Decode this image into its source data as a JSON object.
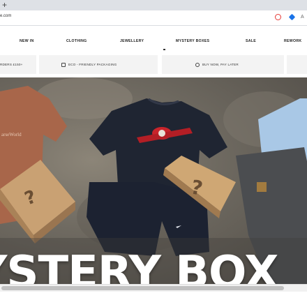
{
  "browser": {
    "new_tab_glyph": "+",
    "url": "e.com",
    "ext_more": "A"
  },
  "nav": {
    "items": [
      {
        "label": "NEW IN"
      },
      {
        "label": "CLOTHING"
      },
      {
        "label": "JEWELLERY"
      },
      {
        "label": "MYSTERY BOXES"
      },
      {
        "label": "SALE"
      },
      {
        "label": "REWORK"
      }
    ]
  },
  "usp": {
    "items": [
      {
        "label": "RDERS £150+",
        "icon": "truck-icon"
      },
      {
        "label": "ECO - FRIENDLY PACKAGING",
        "icon": "box-icon"
      },
      {
        "label": "BUY NOW, PAY LATER",
        "icon": "refresh-icon"
      }
    ]
  },
  "hero": {
    "title": "YSTERY BOX",
    "tee_print": "arseWorld"
  },
  "colors": {
    "chrome_bg": "#dee1e6",
    "usp_bg": "#f3f3f3",
    "hero_text": "#ffffff"
  }
}
